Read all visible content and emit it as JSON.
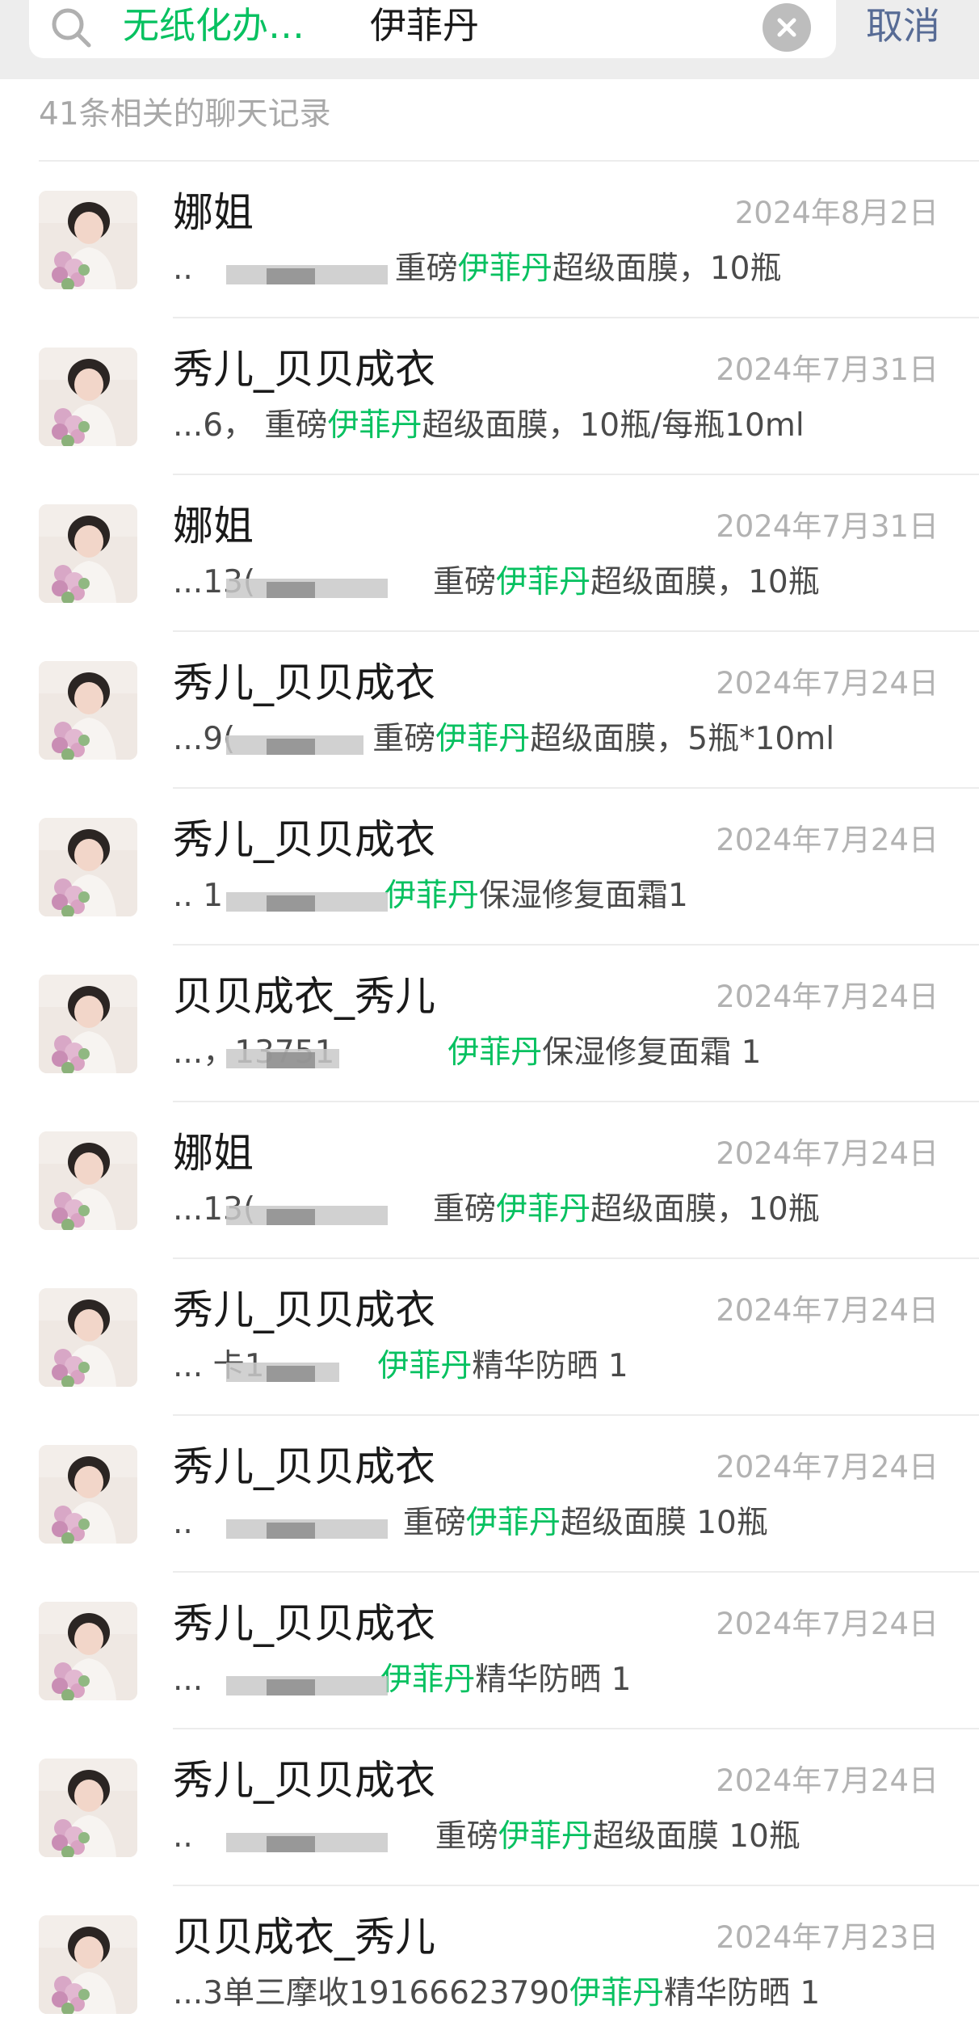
{
  "search": {
    "filter_label": "无纸化办…",
    "query": "伊菲丹",
    "cancel_label": "取消"
  },
  "results_count_text": "41条相关的聊天记录",
  "keyword": "伊菲丹",
  "results": [
    {
      "name": "娜姐",
      "date": "2024年8月2日",
      "prefix": "..",
      "pre_gap": "     ",
      "before": "重磅",
      "after": "超级面膜，10瓶"
    },
    {
      "name": "秀儿_贝贝成衣",
      "date": "2024年7月31日",
      "prefix": "...6，",
      "pre_gap": " ",
      "before": "重磅",
      "after": "超级面膜，10瓶/每瓶10ml"
    },
    {
      "name": "娜姐",
      "date": "2024年7月31日",
      "prefix": "...13(",
      "pre_gap": "    ",
      "before": "重磅",
      "after": "超级面膜，10瓶"
    },
    {
      "name": "秀儿_贝贝成衣",
      "date": "2024年7月24日",
      "prefix": "...9(",
      "pre_gap": "  ",
      "before": "重磅",
      "after": "超级面膜，5瓶*10ml"
    },
    {
      "name": "秀儿_贝贝成衣",
      "date": "2024年7月24日",
      "prefix": ".. 1",
      "pre_gap": "   24，",
      "before": "",
      "after": "保湿修复面霜1"
    },
    {
      "name": "贝贝成衣_秀儿",
      "date": "2024年7月24日",
      "prefix": "...，13751",
      "pre_gap": "  ",
      "before": "",
      "after": "保湿修复面霜 1"
    },
    {
      "name": "娜姐",
      "date": "2024年7月24日",
      "prefix": "...13(",
      "pre_gap": "    ",
      "before": "重磅",
      "after": "超级面膜，10瓶"
    },
    {
      "name": "秀儿_贝贝成衣",
      "date": "2024年7月24日",
      "prefix": "... 卡1",
      "pre_gap": "  855，",
      "before": "",
      "after": "精华防晒  1"
    },
    {
      "name": "秀儿_贝贝成衣",
      "date": "2024年7月24日",
      "prefix": "..",
      "pre_gap": "      ，",
      "before": "重磅",
      "after": "超级面膜 10瓶"
    },
    {
      "name": "秀儿_贝贝成衣",
      "date": "2024年7月24日",
      "prefix": "...",
      "pre_gap": "      6，",
      "before": "",
      "after": "精华防晒 1"
    },
    {
      "name": "秀儿_贝贝成衣",
      "date": "2024年7月24日",
      "prefix": "..",
      "pre_gap": "        ",
      "before": "重磅",
      "after": "超级面膜 10瓶"
    },
    {
      "name": "贝贝成衣_秀儿",
      "date": "2024年7月23日",
      "prefix": "...3单三摩收19166623790",
      "pre_gap": "",
      "before": "",
      "after": "精华防晒 1"
    }
  ],
  "colors": {
    "highlight": "#07c160",
    "link": "#576b95",
    "topbar_bg": "#ededed"
  },
  "icons": {
    "search": "search-icon",
    "clear": "clear-icon",
    "avatar": "avatar-image"
  }
}
